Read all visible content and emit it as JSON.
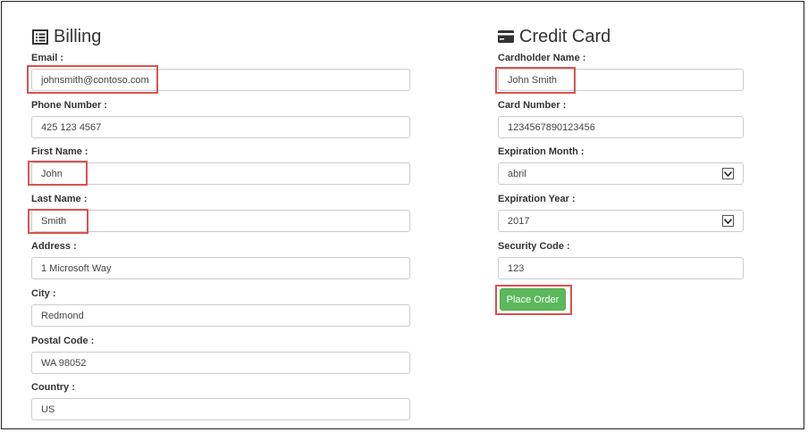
{
  "billing": {
    "title": "Billing",
    "title_icon": "list-icon",
    "email_label": "Email :",
    "email_value": "johnsmith@contoso.com",
    "phone_label": "Phone Number :",
    "phone_value": "425 123 4567",
    "first_name_label": "First Name :",
    "first_name_value": "John",
    "last_name_label": "Last Name :",
    "last_name_value": "Smith",
    "address_label": "Address :",
    "address_value": "1 Microsoft Way",
    "city_label": "City :",
    "city_value": "Redmond",
    "postal_label": "Postal Code :",
    "postal_value": "WA 98052",
    "country_label": "Country :",
    "country_value": "US"
  },
  "credit_card": {
    "title": "Credit Card",
    "title_icon": "credit-card-icon",
    "cardholder_label": "Cardholder Name :",
    "cardholder_value": "John Smith",
    "card_number_label": "Card Number :",
    "card_number_value": "1234567890123456",
    "exp_month_label": "Expiration Month :",
    "exp_month_value": "abril",
    "exp_year_label": "Expiration Year :",
    "exp_year_value": "2017",
    "security_label": "Security Code :",
    "security_value": "123",
    "place_order_label": "Place Order"
  },
  "colors": {
    "highlight": "#d9534f",
    "button": "#5cb85c"
  }
}
